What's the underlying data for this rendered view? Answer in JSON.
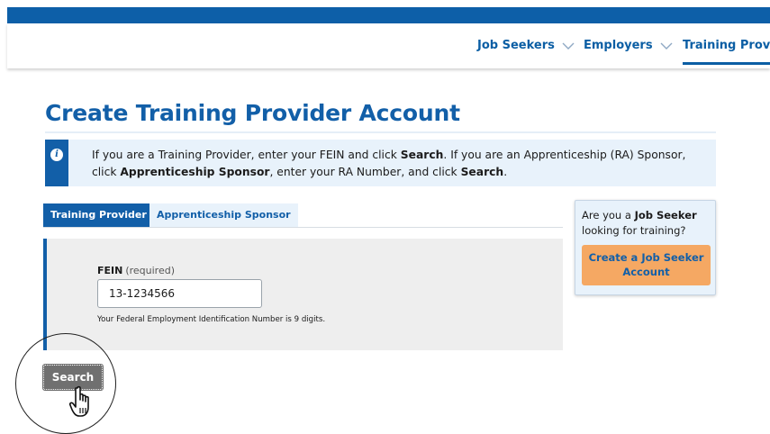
{
  "nav": {
    "items": [
      {
        "label": "Job Seekers"
      },
      {
        "label": "Employers"
      },
      {
        "label": "Training Provic"
      }
    ]
  },
  "page": {
    "title": "Create Training Provider Account"
  },
  "info": {
    "icon": "info-icon",
    "text_1": "If you are a Training Provider, enter your FEIN and click ",
    "bold_1": "Search",
    "text_2": ". If you are an Apprenticeship (RA) Sponsor, click ",
    "bold_2": "Apprenticeship Sponsor",
    "text_3": ", enter your RA Number, and click ",
    "bold_3": "Search",
    "text_4": "."
  },
  "tabs": [
    {
      "label": "Training Provider",
      "active": true
    },
    {
      "label": "Apprenticeship Sponsor",
      "active": false
    }
  ],
  "form": {
    "fein_label": "FEIN",
    "fein_required": "(required)",
    "fein_value": "13-1234566",
    "fein_help": "Your Federal Employment Identification Number is 9 digits."
  },
  "search_button": {
    "label": "Search"
  },
  "side_card": {
    "text_pre": "Are you a ",
    "text_bold": "Job Seeker",
    "text_post": " looking for training?",
    "button_label": "Create a Job Seeker Account"
  },
  "colors": {
    "brand_blue": "#125fa8",
    "cta_orange": "#f5a863",
    "info_bg": "#e8f2fb",
    "search_gray": "#707070"
  }
}
